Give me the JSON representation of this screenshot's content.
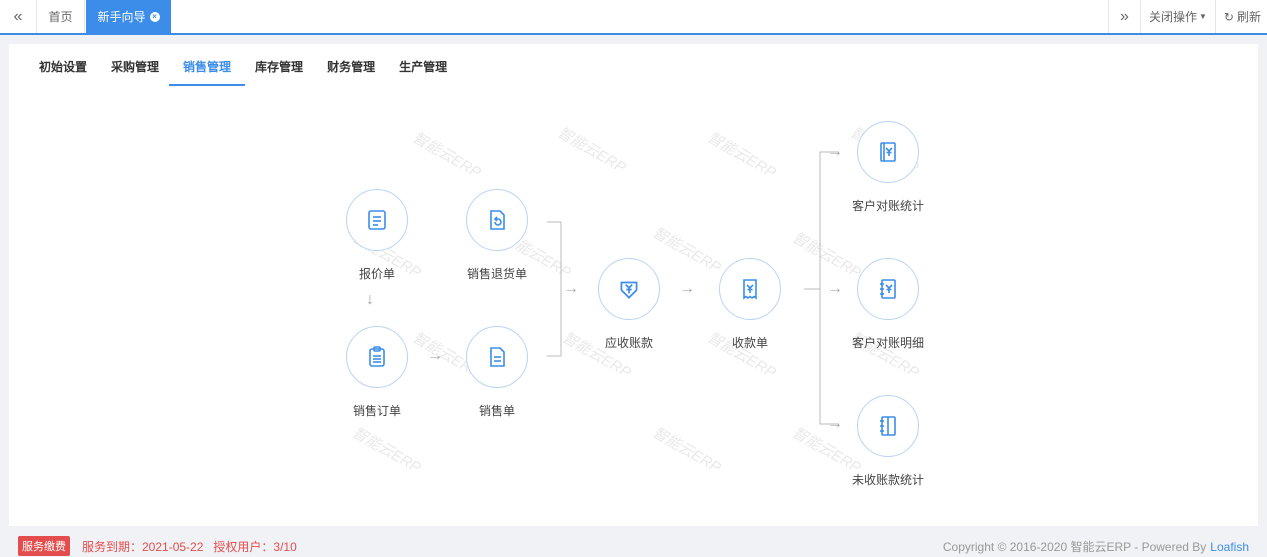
{
  "topbar": {
    "home_tab": "首页",
    "active_tab": "新手向导",
    "close_ops": "关闭操作",
    "refresh": "刷新"
  },
  "nav": {
    "items": [
      "初始设置",
      "采购管理",
      "销售管理",
      "库存管理",
      "财务管理",
      "生产管理"
    ],
    "active": "销售管理"
  },
  "watermark": "智能云ERP",
  "flow": {
    "quote": "报价单",
    "sales_return": "销售退货单",
    "sales_order": "销售订单",
    "sales_slip": "销售单",
    "receivable": "应收账款",
    "receipt": "收款单",
    "customer_stats": "客户对账统计",
    "customer_detail": "客户对账明细",
    "unpaid_stats": "未收账款统计"
  },
  "footer": {
    "badge": "服务缴费",
    "expiry": "服务到期：2021-05-22",
    "users": "授权用户：3/10",
    "copyright": "Copyright © 2016-2020 智能云ERP - Powered By",
    "link": "Loafish"
  },
  "colors": {
    "accent": "#3c8dea",
    "alert": "#e34d4d"
  }
}
